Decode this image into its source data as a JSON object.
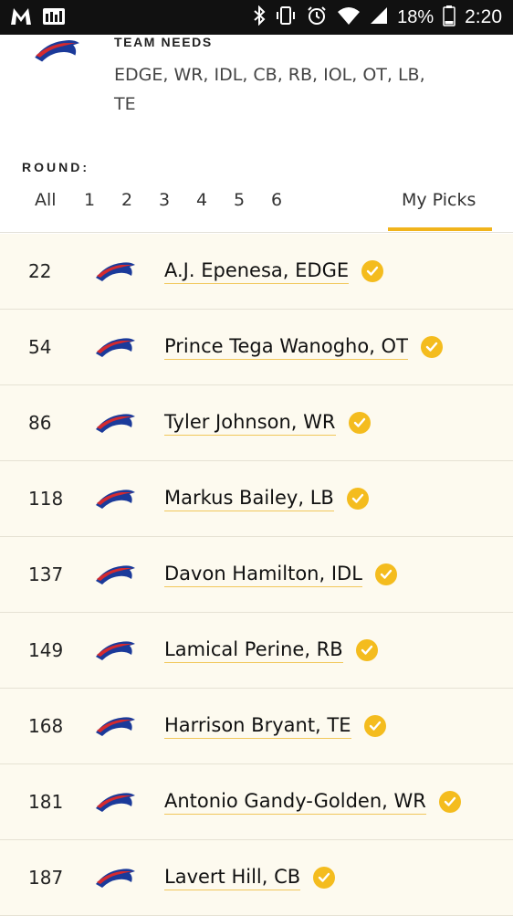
{
  "status_bar": {
    "battery_percent": "18%",
    "time": "2:20",
    "left_icons": [
      "malwarebytes-icon",
      "news-icon"
    ],
    "right_icons": [
      "bluetooth-icon",
      "vibrate-icon",
      "alarm-icon",
      "wifi-icon",
      "signal-icon",
      "battery-icon"
    ]
  },
  "team": {
    "needs_label": "TEAM NEEDS",
    "needs": "EDGE, WR, IDL, CB, RB, IOL, OT, LB, TE"
  },
  "round_label": "ROUND:",
  "tabs": [
    {
      "label": "All"
    },
    {
      "label": "1"
    },
    {
      "label": "2"
    },
    {
      "label": "3"
    },
    {
      "label": "4"
    },
    {
      "label": "5"
    },
    {
      "label": "6"
    },
    {
      "label": "My Picks",
      "selected": true
    }
  ],
  "colors": {
    "accent": "#f1b41c",
    "row_bg": "#fdfaef",
    "bills_blue": "#1b3a9a",
    "bills_red": "#d42a2f"
  },
  "picks": [
    {
      "number": "22",
      "name": "A.J. Epenesa, EDGE"
    },
    {
      "number": "54",
      "name": "Prince Tega Wanogho, OT"
    },
    {
      "number": "86",
      "name": "Tyler Johnson, WR"
    },
    {
      "number": "118",
      "name": "Markus Bailey, LB"
    },
    {
      "number": "137",
      "name": "Davon Hamilton, IDL"
    },
    {
      "number": "149",
      "name": "Lamical Perine, RB"
    },
    {
      "number": "168",
      "name": "Harrison Bryant, TE"
    },
    {
      "number": "181",
      "name": "Antonio Gandy-Golden, WR"
    },
    {
      "number": "187",
      "name": "Lavert Hill, CB"
    }
  ]
}
